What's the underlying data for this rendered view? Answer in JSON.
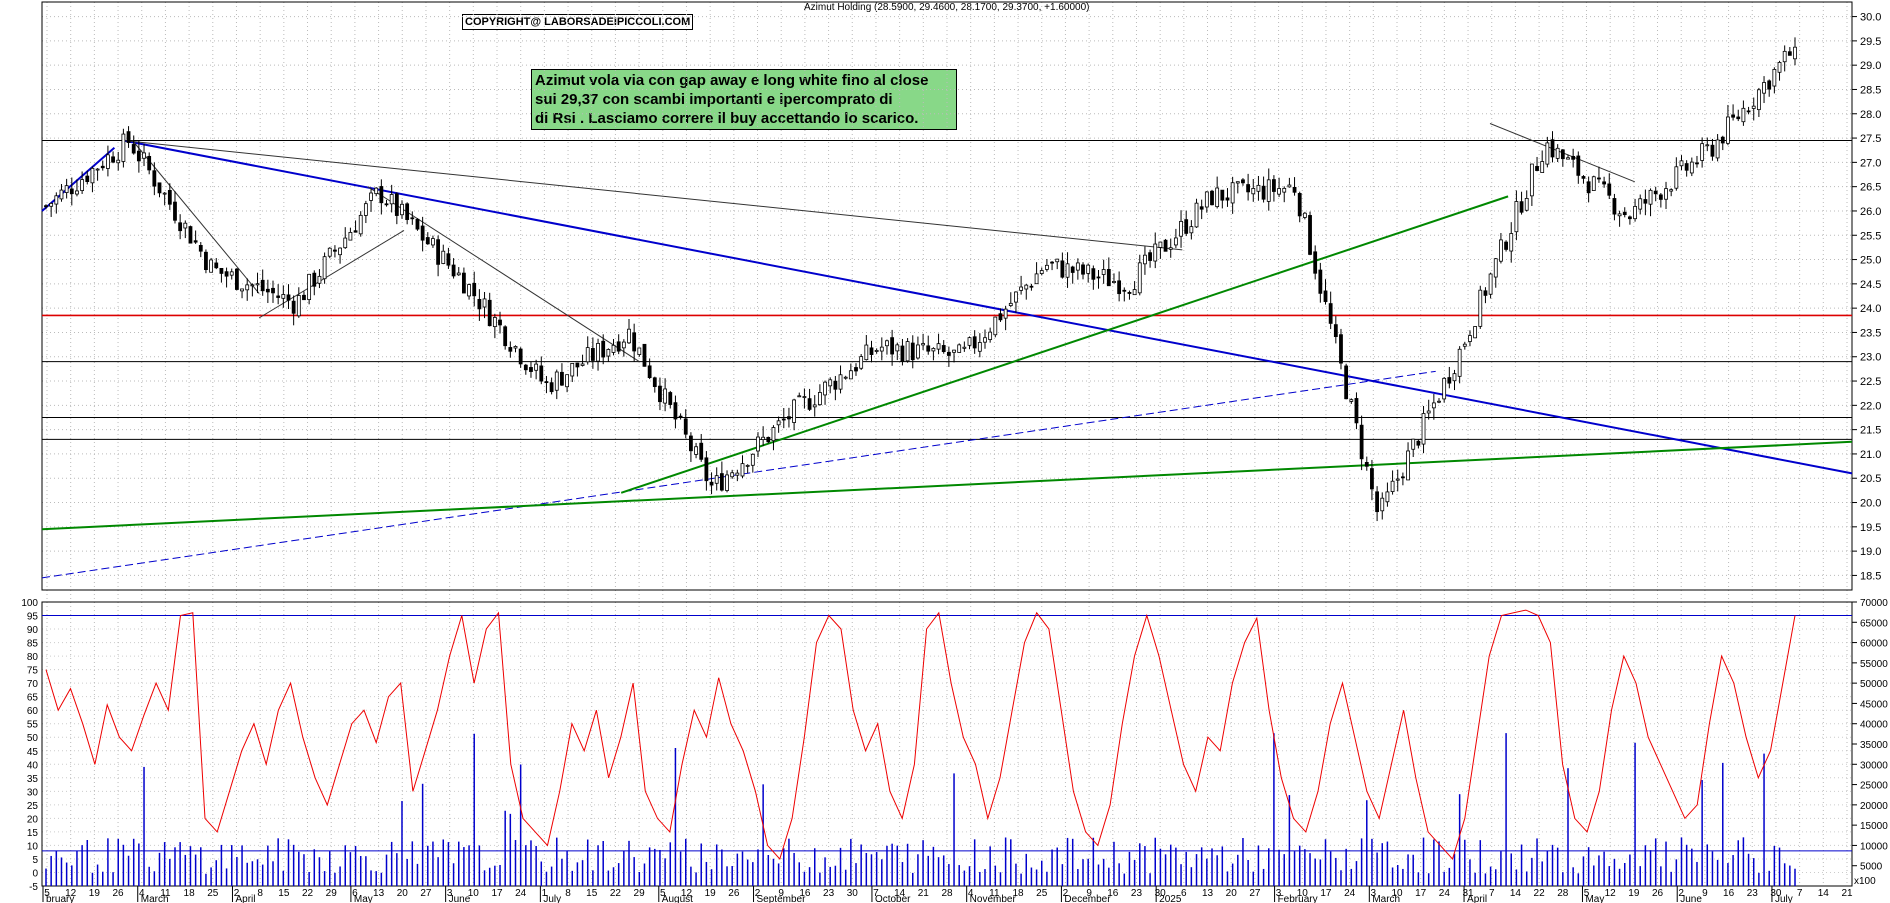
{
  "header": {
    "title": "Azimut Holding (28.5900, 29.4600, 28.1700, 29.3700, +1.60000)"
  },
  "copyright": "COPYRIGHT@ LABORSADEIPICCOLI.COM",
  "annotation": [
    "Azimut vola via con gap away e long white fino al close",
    "sui 29,37 con scambi importanti e ipercomprato di",
    "di Rsi . Lasciamo correre il buy accettando lo scarico."
  ],
  "chart_data": [
    {
      "type": "candlestick",
      "ylim": [
        18.2,
        30.3
      ],
      "y_ticks": [
        "18.5",
        "19.0",
        "19.5",
        "20.0",
        "20.5",
        "21.0",
        "21.5",
        "22.0",
        "22.5",
        "23.0",
        "23.5",
        "24.0",
        "24.5",
        "25.0",
        "25.5",
        "26.0",
        "26.5",
        "27.0",
        "27.5",
        "28.0",
        "28.5",
        "29.0",
        "29.5",
        "30.0"
      ],
      "x_ticks": [
        "5",
        "12",
        "19",
        "26",
        "4",
        "11",
        "18",
        "25",
        "2",
        "8",
        "15",
        "22",
        "29",
        "6",
        "13",
        "20",
        "27",
        "3",
        "10",
        "17",
        "24",
        "1",
        "8",
        "15",
        "22",
        "29",
        "5",
        "12",
        "19",
        "26",
        "2",
        "9",
        "16",
        "23",
        "30",
        "7",
        "14",
        "21",
        "28",
        "4",
        "11",
        "18",
        "25",
        "2",
        "9",
        "16",
        "23",
        "30",
        "6",
        "13",
        "20",
        "27",
        "3",
        "10",
        "17",
        "24",
        "3",
        "10",
        "17",
        "24",
        "31",
        "7",
        "14",
        "22",
        "28",
        "5",
        "12",
        "19",
        "26",
        "2",
        "9",
        "16",
        "23",
        "30",
        "7",
        "14",
        "21"
      ],
      "months": [
        "bruary",
        "March",
        "April",
        "May",
        "June",
        "July",
        "August",
        "September",
        "October",
        "November",
        "December",
        "2025",
        "February",
        "March",
        "April",
        "May",
        "June",
        "July"
      ],
      "horizontal_levels": [
        {
          "value": 27.45,
          "color": "#000000"
        },
        {
          "value": 23.85,
          "color": "#dd0000"
        },
        {
          "value": 22.9,
          "color": "#000000"
        },
        {
          "value": 21.75,
          "color": "#000000"
        },
        {
          "value": 21.3,
          "color": "#000000"
        },
        {
          "value": 18.2,
          "color": "#000000"
        }
      ],
      "last_close": 29.37,
      "prices": [
        {
          "date": "Feb 2024",
          "close": 26.1
        },
        {
          "date": "early Mar 2024",
          "close": 27.45
        },
        {
          "date": "mid Mar 2024",
          "close": 24.8
        },
        {
          "date": "Apr 2024",
          "close": 24.1
        },
        {
          "date": "May 2024",
          "close": 26.4
        },
        {
          "date": "Jun 2024",
          "close": 24.6
        },
        {
          "date": "late Jun 2024",
          "close": 22.4
        },
        {
          "date": "Jul 2024",
          "close": 23.5
        },
        {
          "date": "early Aug 2024",
          "close": 20.3
        },
        {
          "date": "Sep 2024",
          "close": 21.9
        },
        {
          "date": "Oct 2024",
          "close": 23.2
        },
        {
          "date": "Nov 2024",
          "close": 23.0
        },
        {
          "date": "Dec 2024",
          "close": 24.9
        },
        {
          "date": "Jan 2025",
          "close": 24.5
        },
        {
          "date": "Feb 2025",
          "close": 26.3
        },
        {
          "date": "Mar 2025",
          "close": 26.5
        },
        {
          "date": "early Apr 2025",
          "close": 19.7
        },
        {
          "date": "late Apr 2025",
          "close": 23.2
        },
        {
          "date": "May 2025",
          "close": 27.4
        },
        {
          "date": "Jun 2025",
          "close": 25.9
        },
        {
          "date": "early Jul 2025",
          "close": 27.3
        },
        {
          "date": "Jul 2025",
          "close": 29.37
        }
      ]
    },
    {
      "type": "line",
      "indicator": "RSI",
      "ylim": [
        -5,
        100
      ],
      "y_ticks": [
        "-5",
        "0",
        "5",
        "10",
        "15",
        "20",
        "25",
        "30",
        "35",
        "40",
        "45",
        "50",
        "55",
        "60",
        "65",
        "70",
        "75",
        "80",
        "85",
        "90",
        "95",
        "100"
      ],
      "levels": [
        8,
        95
      ],
      "values": [
        75,
        60,
        68,
        55,
        40,
        62,
        50,
        45,
        58,
        70,
        60,
        95,
        96,
        20,
        15,
        30,
        45,
        55,
        40,
        60,
        70,
        50,
        35,
        25,
        40,
        55,
        60,
        48,
        65,
        70,
        30,
        45,
        60,
        80,
        95,
        70,
        90,
        96,
        40,
        20,
        15,
        10,
        30,
        55,
        45,
        60,
        35,
        50,
        70,
        30,
        20,
        15,
        40,
        60,
        50,
        72,
        55,
        45,
        30,
        10,
        5,
        20,
        50,
        85,
        95,
        90,
        60,
        45,
        55,
        30,
        20,
        40,
        90,
        96,
        70,
        50,
        40,
        20,
        35,
        60,
        85,
        96,
        90,
        60,
        30,
        15,
        10,
        25,
        55,
        80,
        95,
        80,
        60,
        40,
        30,
        50,
        45,
        70,
        85,
        94,
        60,
        35,
        20,
        15,
        30,
        55,
        70,
        50,
        30,
        20,
        40,
        60,
        35,
        15,
        10,
        5,
        20,
        50,
        80,
        95,
        96,
        97,
        95,
        85,
        40,
        20,
        15,
        30,
        60,
        80,
        70,
        50,
        40,
        30,
        20,
        25,
        55,
        80,
        70,
        50,
        35,
        45,
        70,
        95
      ]
    },
    {
      "type": "bar",
      "indicator": "Volume",
      "ylim": [
        0,
        70000
      ],
      "y_ticks": [
        "5000",
        "10000",
        "15000",
        "20000",
        "25000",
        "30000",
        "35000",
        "40000",
        "45000",
        "50000",
        "55000",
        "60000",
        "65000",
        "70000"
      ],
      "unit_label": "x100"
    }
  ]
}
